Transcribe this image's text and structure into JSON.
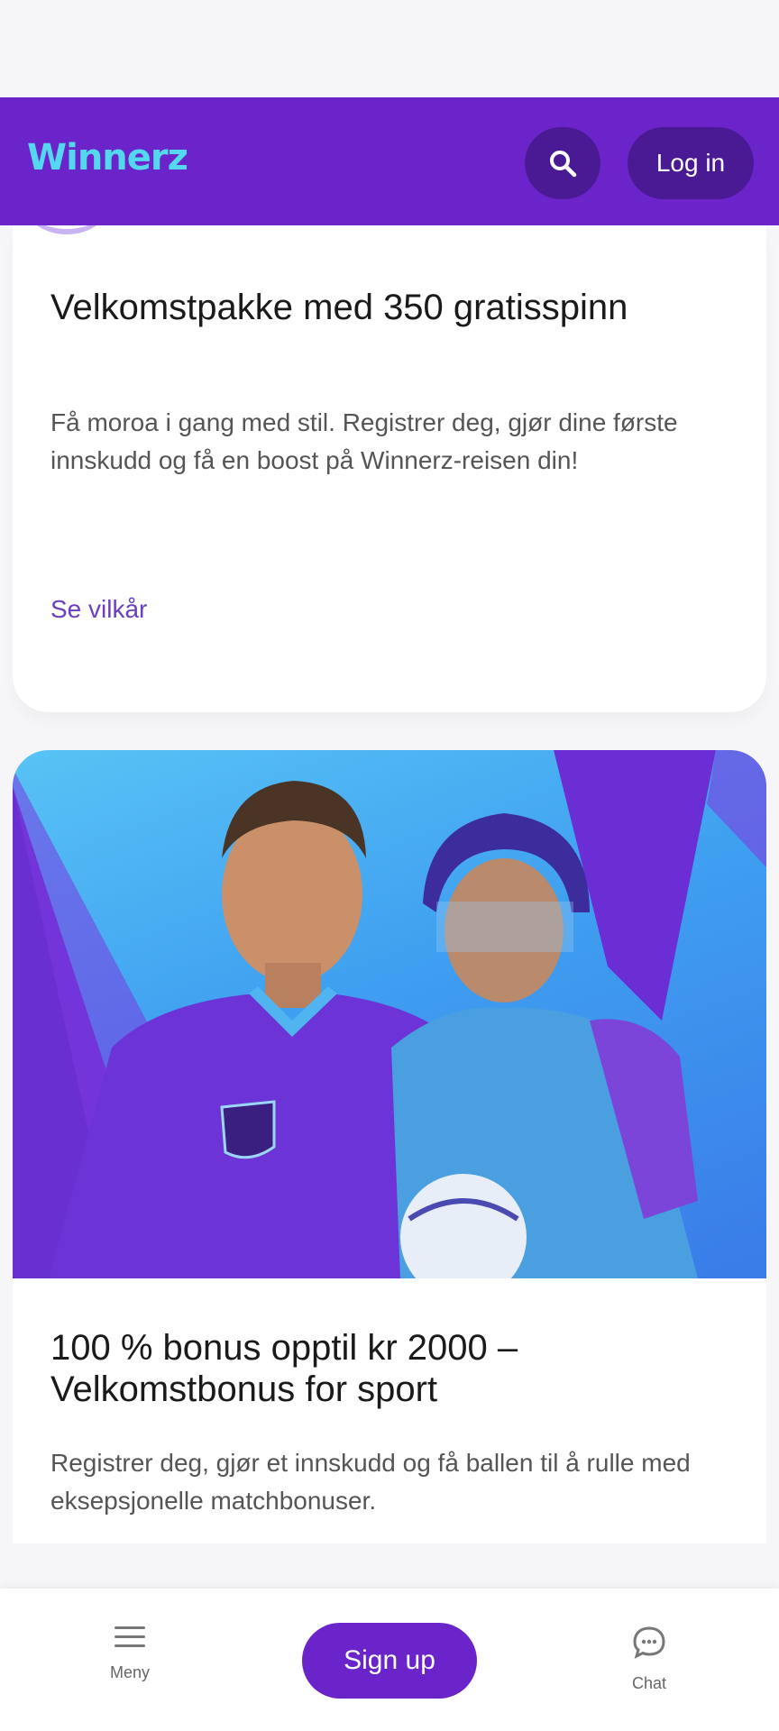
{
  "header": {
    "logo_text": "Winnerz",
    "login_label": "Log in",
    "search_icon": "search-icon"
  },
  "promos": [
    {
      "title": "Velkomstpakke med 350 gratisspinn",
      "description": "Få moroa i gang med stil. Registrer deg, gjør dine første innskudd og få en boost på Winnerz-reisen din!",
      "terms_label": "Se vilkår"
    },
    {
      "title": "100 % bonus opptil kr 2000 – Velkomstbonus for sport",
      "description": "Registrer deg, gjør et innskudd og få ballen til å rulle med eksepsjonelle matchbonuser."
    }
  ],
  "bottom_nav": {
    "menu_label": "Meny",
    "signup_label": "Sign up",
    "chat_label": "Chat"
  },
  "colors": {
    "brand_purple": "#6a24c9",
    "brand_dark_purple": "#4a1a94",
    "logo_cyan": "#53d8f0",
    "link_purple": "#6a3fc0"
  }
}
